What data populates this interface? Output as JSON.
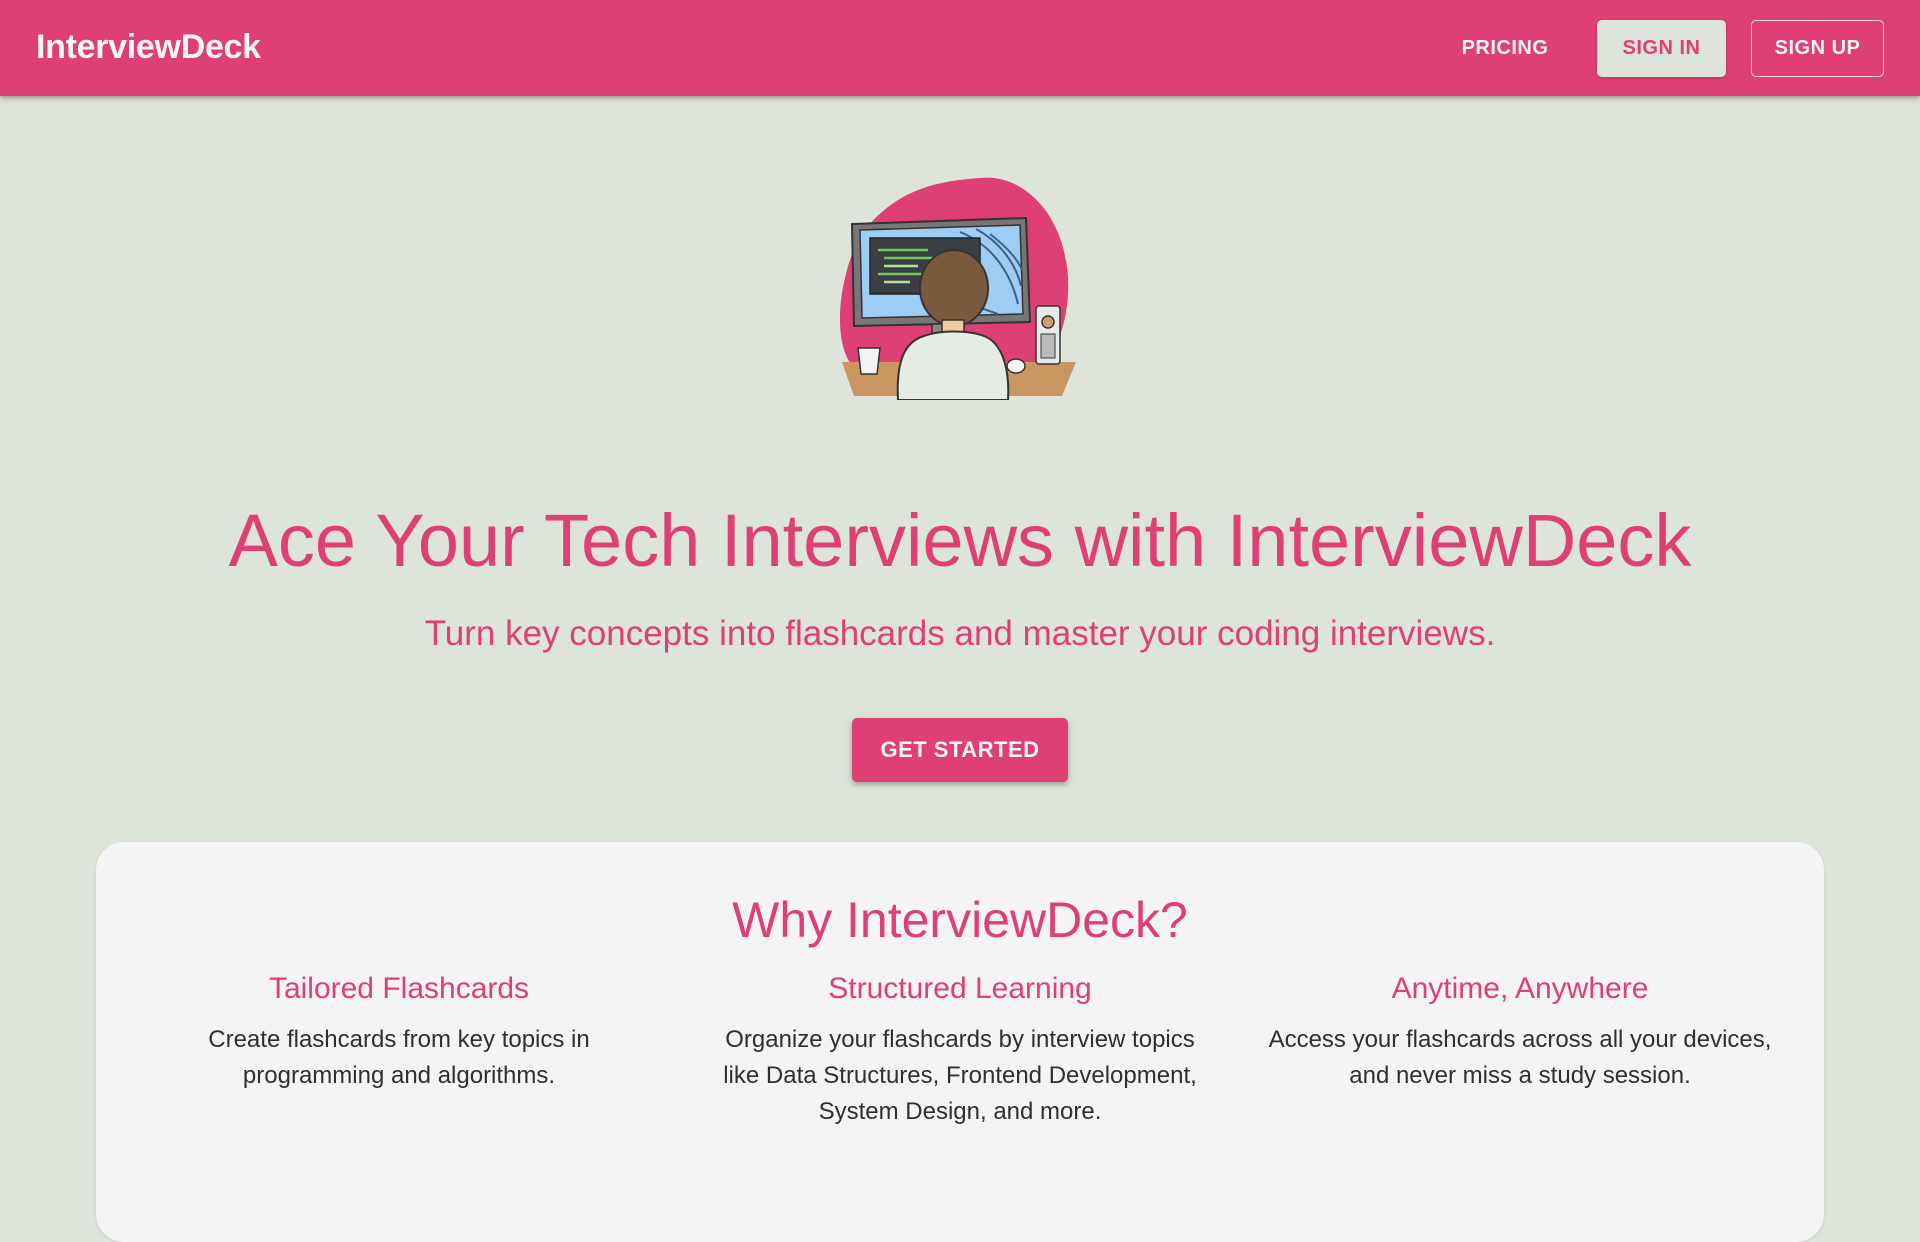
{
  "header": {
    "brand": "InterviewDeck",
    "nav": {
      "pricing": "PRICING",
      "sign_in": "SIGN IN",
      "sign_up": "SIGN UP"
    }
  },
  "hero": {
    "illustration": "developer-at-computer-illustration",
    "title": "Ace Your Tech Interviews with InterviewDeck",
    "subtitle": "Turn key concepts into flashcards and master your coding interviews.",
    "cta_label": "GET STARTED"
  },
  "why": {
    "title": "Why InterviewDeck?",
    "features": [
      {
        "title": "Tailored Flashcards",
        "description": "Create flashcards from key topics in programming and algorithms."
      },
      {
        "title": "Structured Learning",
        "description": "Organize your flashcards by interview topics like Data Structures, Frontend Development, System Design, and more."
      },
      {
        "title": "Anytime, Anywhere",
        "description": "Access your flashcards across all your devices, and never miss a study session."
      }
    ]
  },
  "colors": {
    "primary": "#de3f74",
    "background": "#dde5da",
    "card": "#f4f4f4",
    "text_dark": "#2f2f2f",
    "text_light": "#f4f4f4"
  }
}
